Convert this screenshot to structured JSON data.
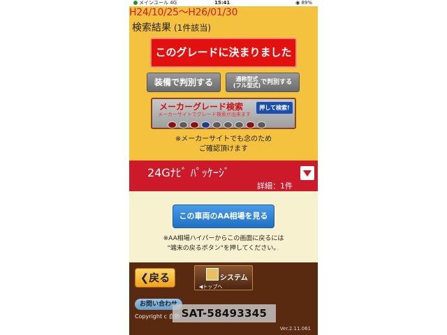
{
  "status_bar": {
    "carrier": "メインユール 4G",
    "time": "15:41",
    "battery": "89%"
  },
  "date_range": "H24/10/25〜H26/01/30",
  "result": {
    "title": "検索結果",
    "count": "(1件該当)"
  },
  "buttons": {
    "decide": "このグレードに決まりました",
    "by_equipment": "装備で判別する",
    "by_model_main": "通称型式",
    "by_model_sub": "(フル型式)",
    "by_model_suffix": "で判別する"
  },
  "maker_search": {
    "title": "メーカーグレード検索",
    "subtitle": "メーカーサイトでグレード検索が出来ます",
    "push": "押して検索!",
    "logos": [
      "toyota-logo",
      "lexus-logo",
      "nissan-logo",
      "subaru-logo",
      "mazda-logo",
      "honda-logo",
      "suzuki-logo",
      "mitsubishi-logo",
      "daihatsu-logo"
    ]
  },
  "notice1": {
    "line1": "※メーカーサイトでも念のため",
    "line2": "ご確認頂けます"
  },
  "grade": {
    "name": "24Gﾅﾋﾞ ﾊﾟｯｹｰｼﾞ",
    "detail": "詳細：1件"
  },
  "aa": {
    "button": "この車両のAA相場を見る",
    "note_line1": "※AA相場ハイパーからこの画面に戻るには",
    "note_line2": "\"端末の戻るボタン\"を押してください。"
  },
  "footer": {
    "back": "戻る",
    "system": "システム",
    "to_top": "◀トップへ",
    "contact": "お問い合わせ",
    "copyright": "Copyright c 自動",
    "version": "Ver.2.11.061"
  },
  "watermark": "SAT-58493345",
  "colors": {
    "accent_yellow": "#f5c240",
    "grade_red": "#cc1a2a",
    "decide_red": "#e31010",
    "aa_blue": "#1f6fc4"
  }
}
